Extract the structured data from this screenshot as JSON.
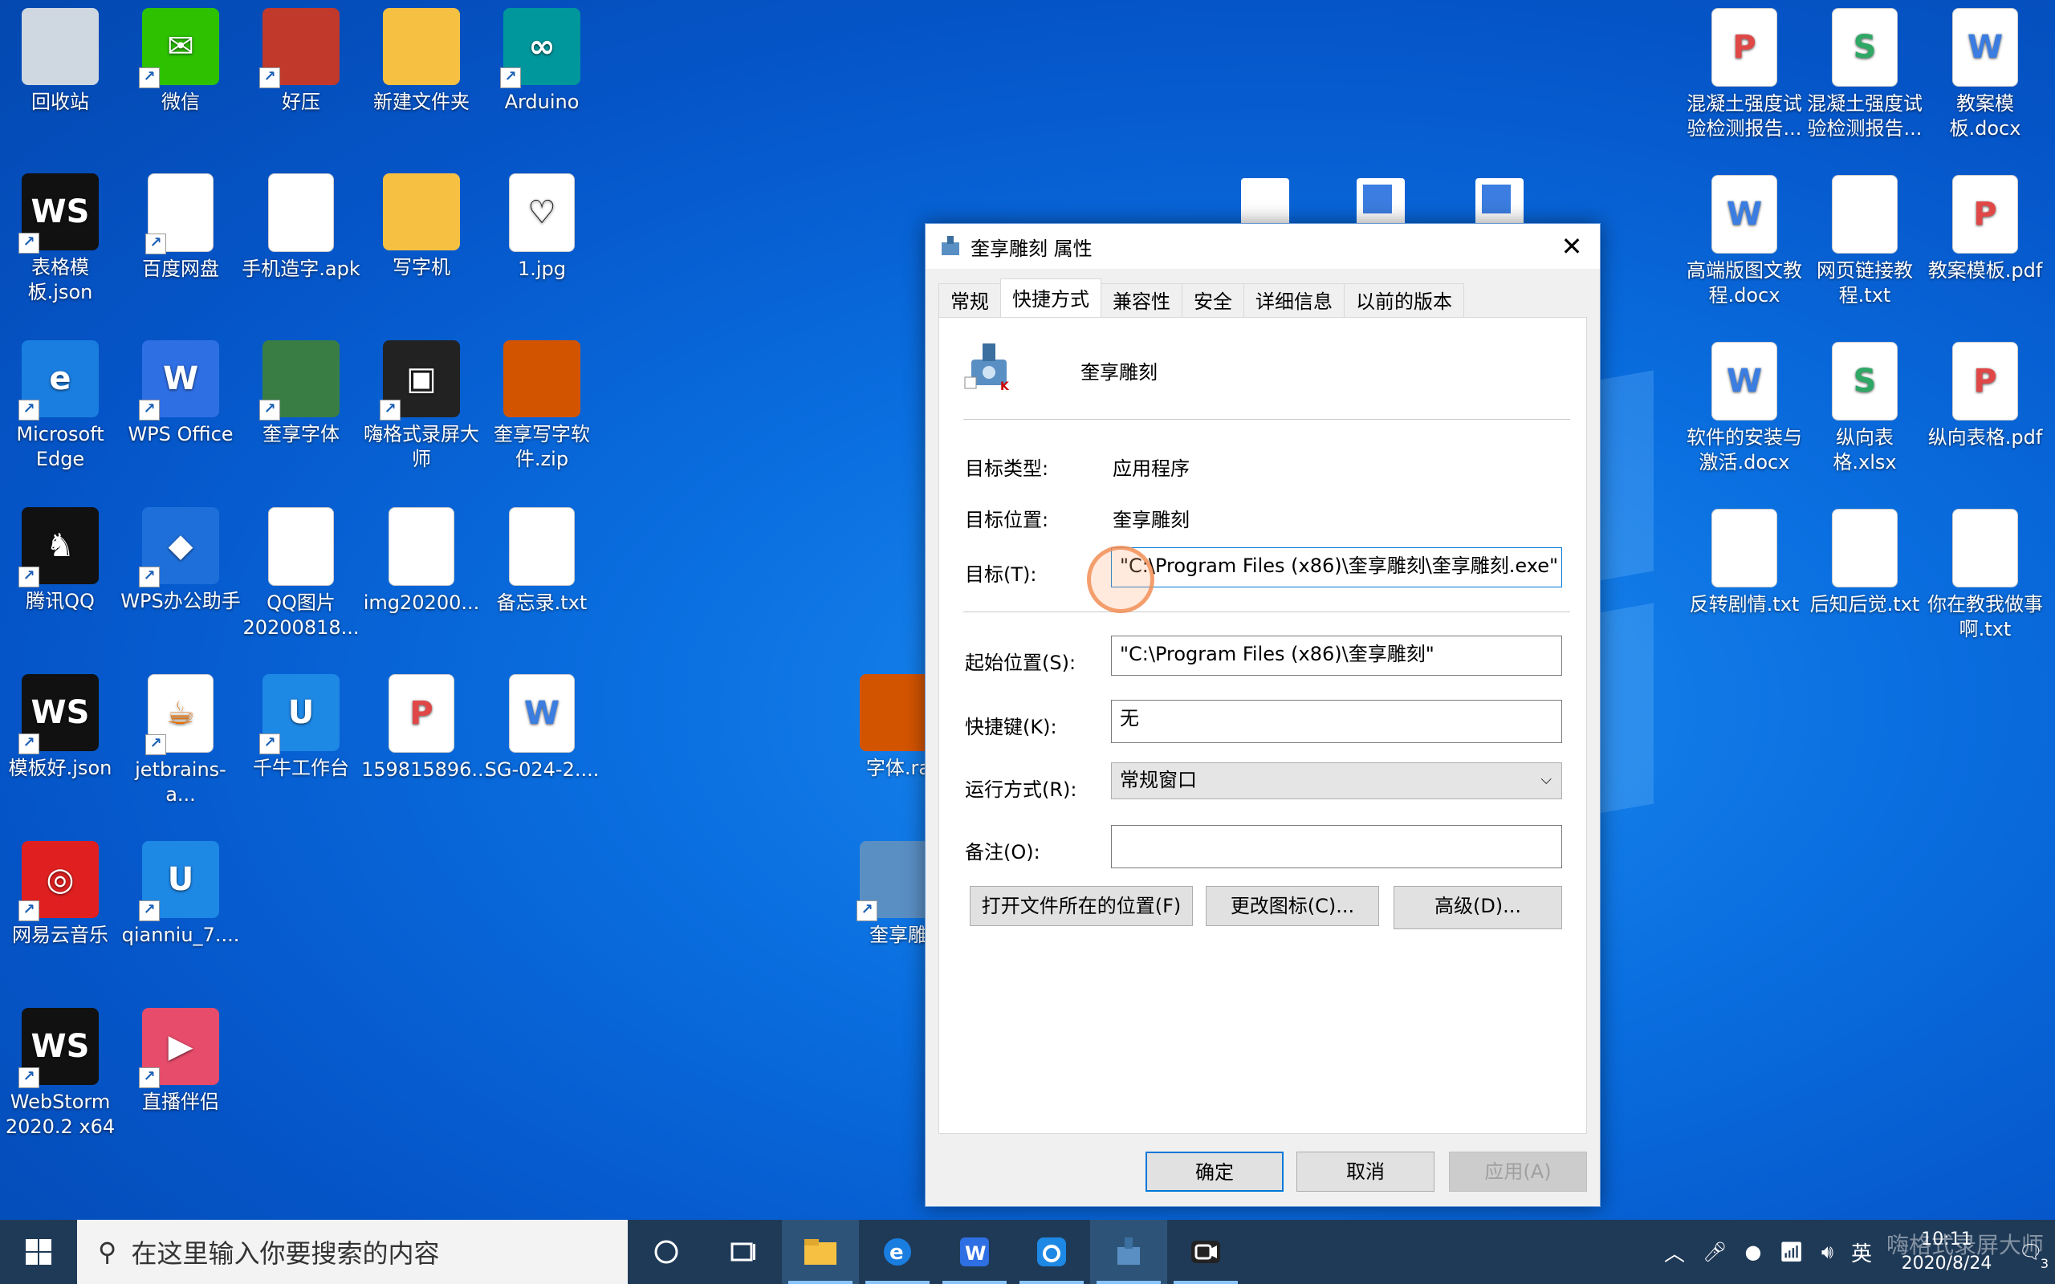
{
  "desktop_left_icons": [
    {
      "label": "回收站",
      "icon": "recycle-bin-icon"
    },
    {
      "label": "微信",
      "icon": "wechat-icon"
    },
    {
      "label": "好压",
      "icon": "haozip-icon"
    },
    {
      "label": "新建文件夹",
      "icon": "folder-icon"
    },
    {
      "label": "Arduino",
      "icon": "arduino-icon"
    },
    {
      "label": "表格模板.json",
      "icon": "webstorm-icon"
    },
    {
      "label": "百度网盘",
      "icon": "baidu-netdisk-icon"
    },
    {
      "label": "手机造字.apk",
      "icon": "file-icon"
    },
    {
      "label": "写字机",
      "icon": "folder-icon"
    },
    {
      "label": "1.jpg",
      "icon": "heart-image-icon"
    },
    {
      "label": "Microsoft Edge",
      "icon": "edge-icon"
    },
    {
      "label": "WPS Office",
      "icon": "wps-icon"
    },
    {
      "label": "奎享字体",
      "icon": "font-app-icon"
    },
    {
      "label": "嗨格式录屏大师",
      "icon": "screen-recorder-icon"
    },
    {
      "label": "奎享写字软件.zip",
      "icon": "zip-icon"
    },
    {
      "label": "腾讯QQ",
      "icon": "qq-icon"
    },
    {
      "label": "WPS办公助手",
      "icon": "wps-assistant-icon"
    },
    {
      "label": "QQ图片20200818...",
      "icon": "qr-image-icon"
    },
    {
      "label": "img20200...",
      "icon": "image-doc-icon"
    },
    {
      "label": "备忘录.txt",
      "icon": "txt-icon"
    },
    {
      "label": "模板好.json",
      "icon": "webstorm-icon"
    },
    {
      "label": "jetbrains-a...",
      "icon": "java-icon"
    },
    {
      "label": "千牛工作台",
      "icon": "qianniu-icon"
    },
    {
      "label": "159815896...",
      "icon": "pdf-icon"
    },
    {
      "label": "SG-024-2....",
      "icon": "word-icon"
    },
    {
      "label": "网易云音乐",
      "icon": "netease-music-icon"
    },
    {
      "label": "qianniu_7....",
      "icon": "qianniu-installer-icon"
    },
    {
      "label": "WebStorm 2020.2 x64",
      "icon": "webstorm-icon"
    },
    {
      "label": "直播伴侣",
      "icon": "live-companion-icon"
    }
  ],
  "desktop_right_icons": [
    {
      "label": "混凝土强度试验检测报告...",
      "icon": "pdf-doc-icon"
    },
    {
      "label": "混凝土强度试验检测报告...",
      "icon": "sheet-doc-icon"
    },
    {
      "label": "教案模板.docx",
      "icon": "word-doc-icon"
    },
    {
      "label": "高端版图文教程.docx",
      "icon": "word-doc-icon"
    },
    {
      "label": "网页链接教程.txt",
      "icon": "txt-icon"
    },
    {
      "label": "教案模板.pdf",
      "icon": "pdf-doc-icon"
    },
    {
      "label": "软件的安装与激活.docx",
      "icon": "word-doc-icon"
    },
    {
      "label": "纵向表格.xlsx",
      "icon": "sheet-doc-icon"
    },
    {
      "label": "纵向表格.pdf",
      "icon": "pdf-doc-icon"
    },
    {
      "label": "反转剧情.txt",
      "icon": "txt-icon"
    },
    {
      "label": "后知后觉.txt",
      "icon": "txt-icon"
    },
    {
      "label": "你在教我做事啊.txt",
      "icon": "txt-icon"
    }
  ],
  "desktop_middle_icons": [
    {
      "label": "字体.ra",
      "icon": "zip-icon"
    },
    {
      "label": "奎享雕",
      "icon": "kuixiang-icon"
    }
  ],
  "dialog": {
    "title": "奎享雕刻 属性",
    "tabs": [
      "常规",
      "快捷方式",
      "兼容性",
      "安全",
      "详细信息",
      "以前的版本"
    ],
    "active_tab": "快捷方式",
    "app_name": "奎享雕刻",
    "target_type_label": "目标类型:",
    "target_type_value": "应用程序",
    "target_location_label": "目标位置:",
    "target_location_value": "奎享雕刻",
    "target_label": "目标(T):",
    "target_value": "\"C:\\Program Files (x86)\\奎享雕刻\\奎享雕刻.exe\"",
    "start_in_label": "起始位置(S):",
    "start_in_value": "\"C:\\Program Files (x86)\\奎享雕刻\"",
    "shortcut_key_label": "快捷键(K):",
    "shortcut_key_value": "无",
    "run_label": "运行方式(R):",
    "run_value": "常规窗口",
    "comment_label": "备注(O):",
    "comment_value": "",
    "open_location_btn": "打开文件所在的位置(F)",
    "change_icon_btn": "更改图标(C)...",
    "advanced_btn": "高级(D)...",
    "ok_btn": "确定",
    "cancel_btn": "取消",
    "apply_btn": "应用(A)"
  },
  "taskbar": {
    "search_placeholder": "在这里输入你要搜索的内容",
    "ime": "英",
    "time": "10:11",
    "date": "2020/8/24",
    "notifications": "3",
    "watermark": "嗨格式录屏大师"
  }
}
